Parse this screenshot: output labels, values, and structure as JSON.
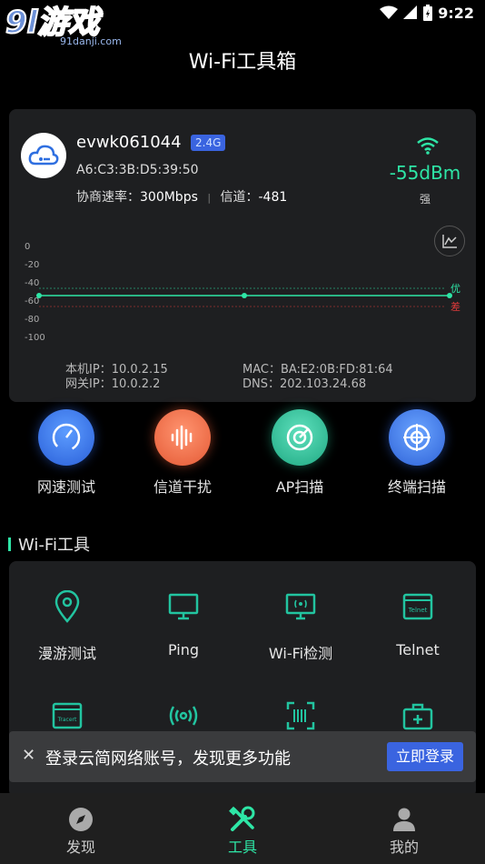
{
  "logo": {
    "big": "9l游戏",
    "small": "91danji.com"
  },
  "status": {
    "time": "9:22"
  },
  "app_title": "Wi-Fi工具箱",
  "wifi": {
    "ssid": "evwk061044",
    "band": "2.4G",
    "mac": "A6:C3:3B:D5:39:50",
    "rate_label": "协商速率：",
    "rate_value": "300Mbps",
    "channel_label": "信道：",
    "channel_value": "-481",
    "signal": "-55dBm",
    "quality": "强",
    "local_ip_label": "本机IP：",
    "local_ip": "10.0.2.15",
    "gateway_label": "网关IP：",
    "gateway": "10.0.2.2",
    "mac_label": "MAC：",
    "mac_value": "BA:E2:0B:FD:81:64",
    "dns_label": "DNS：",
    "dns": "202.103.24.68"
  },
  "chart_data": {
    "type": "line",
    "ylim": [
      -100,
      0
    ],
    "yticks": [
      "0",
      "-20",
      "-40",
      "-60",
      "-80",
      "-100"
    ],
    "series": [
      {
        "values": [
          -55,
          -55,
          -55
        ]
      }
    ],
    "thresholds": [
      {
        "label": "优",
        "value": -47,
        "color": "#2ee6a6"
      },
      {
        "label": "差",
        "value": -67,
        "color": "#e03a3a"
      }
    ]
  },
  "quick_actions": [
    {
      "label": "网速测试",
      "icon": "speedometer-icon",
      "color": "#3a7af0"
    },
    {
      "label": "信道干扰",
      "icon": "soundwave-icon",
      "color": "#f0704a"
    },
    {
      "label": "AP扫描",
      "icon": "radar-icon",
      "color": "#2fc49a"
    },
    {
      "label": "终端扫描",
      "icon": "target-icon",
      "color": "#3a7af0"
    }
  ],
  "section_title": "Wi-Fi工具",
  "tools": [
    {
      "label": "漫游测试",
      "icon": "location-pin-icon"
    },
    {
      "label": "Ping",
      "icon": "monitor-icon"
    },
    {
      "label": "Wi-Fi检测",
      "icon": "wifi-detect-icon"
    },
    {
      "label": "Telnet",
      "icon": "telnet-icon",
      "tag": "Telnet"
    },
    {
      "label": "",
      "icon": "tracert-icon",
      "tag": "Tracert"
    },
    {
      "label": "",
      "icon": "broadcast-icon"
    },
    {
      "label": "",
      "icon": "scan-icon"
    },
    {
      "label": "",
      "icon": "toolbox-icon"
    }
  ],
  "banner": {
    "message": "登录云简网络账号，发现更多功能",
    "button": "立即登录"
  },
  "nav": [
    {
      "label": "发现",
      "icon": "compass-icon"
    },
    {
      "label": "工具",
      "icon": "tools-icon"
    },
    {
      "label": "我的",
      "icon": "person-icon"
    }
  ]
}
